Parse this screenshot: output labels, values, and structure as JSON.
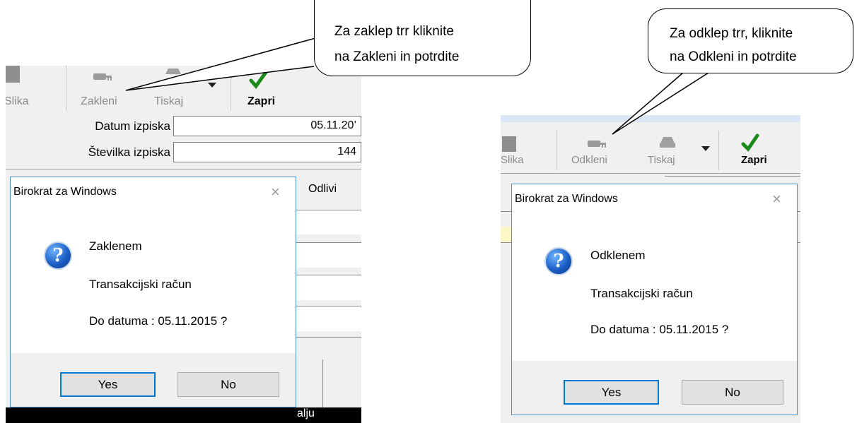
{
  "left": {
    "toolbar": {
      "slika": "Slika",
      "lock": "Zakleni",
      "print": "Tiskaj",
      "close": "Zapri"
    },
    "fields": {
      "date_label": "Datum izpiska",
      "date_value": "05.11.20’",
      "number_label": "Številka izpiska",
      "number_value": "144"
    },
    "grid": {
      "col_header": "Odlivi",
      "footer_text": "alju"
    },
    "dialog": {
      "title": "Birokrat za Windows",
      "line1": "Zaklenem",
      "line2": "Transakcijski račun",
      "line3": "Do datuma : 05.11.2015 ?",
      "yes": "Yes",
      "no": "No"
    },
    "callout": {
      "line1": "Za zaklep trr kliknite",
      "line2": "na  Zakleni in potrdite"
    }
  },
  "right": {
    "toolbar": {
      "slika": "Slika",
      "unlock": "Odkleni",
      "print": "Tiskaj",
      "close": "Zapri"
    },
    "dialog": {
      "title": "Birokrat za Windows",
      "line1": "Odklenem",
      "line2": "Transakcijski račun",
      "line3": "Do datuma : 05.11.2015 ?",
      "yes": "Yes",
      "no": "No"
    },
    "callout": {
      "line1": "Za odklep trr, kliknite",
      "line2": "na Odkleni in potrdite"
    }
  },
  "colors": {
    "accent": "#0078d7",
    "dialog_border": "#4a8fd0",
    "check_green": "#1a8a1a"
  },
  "icons": [
    "question-icon",
    "key-icon",
    "printer-icon",
    "checkmark-icon",
    "close-icon",
    "dropdown-arrow-icon"
  ]
}
